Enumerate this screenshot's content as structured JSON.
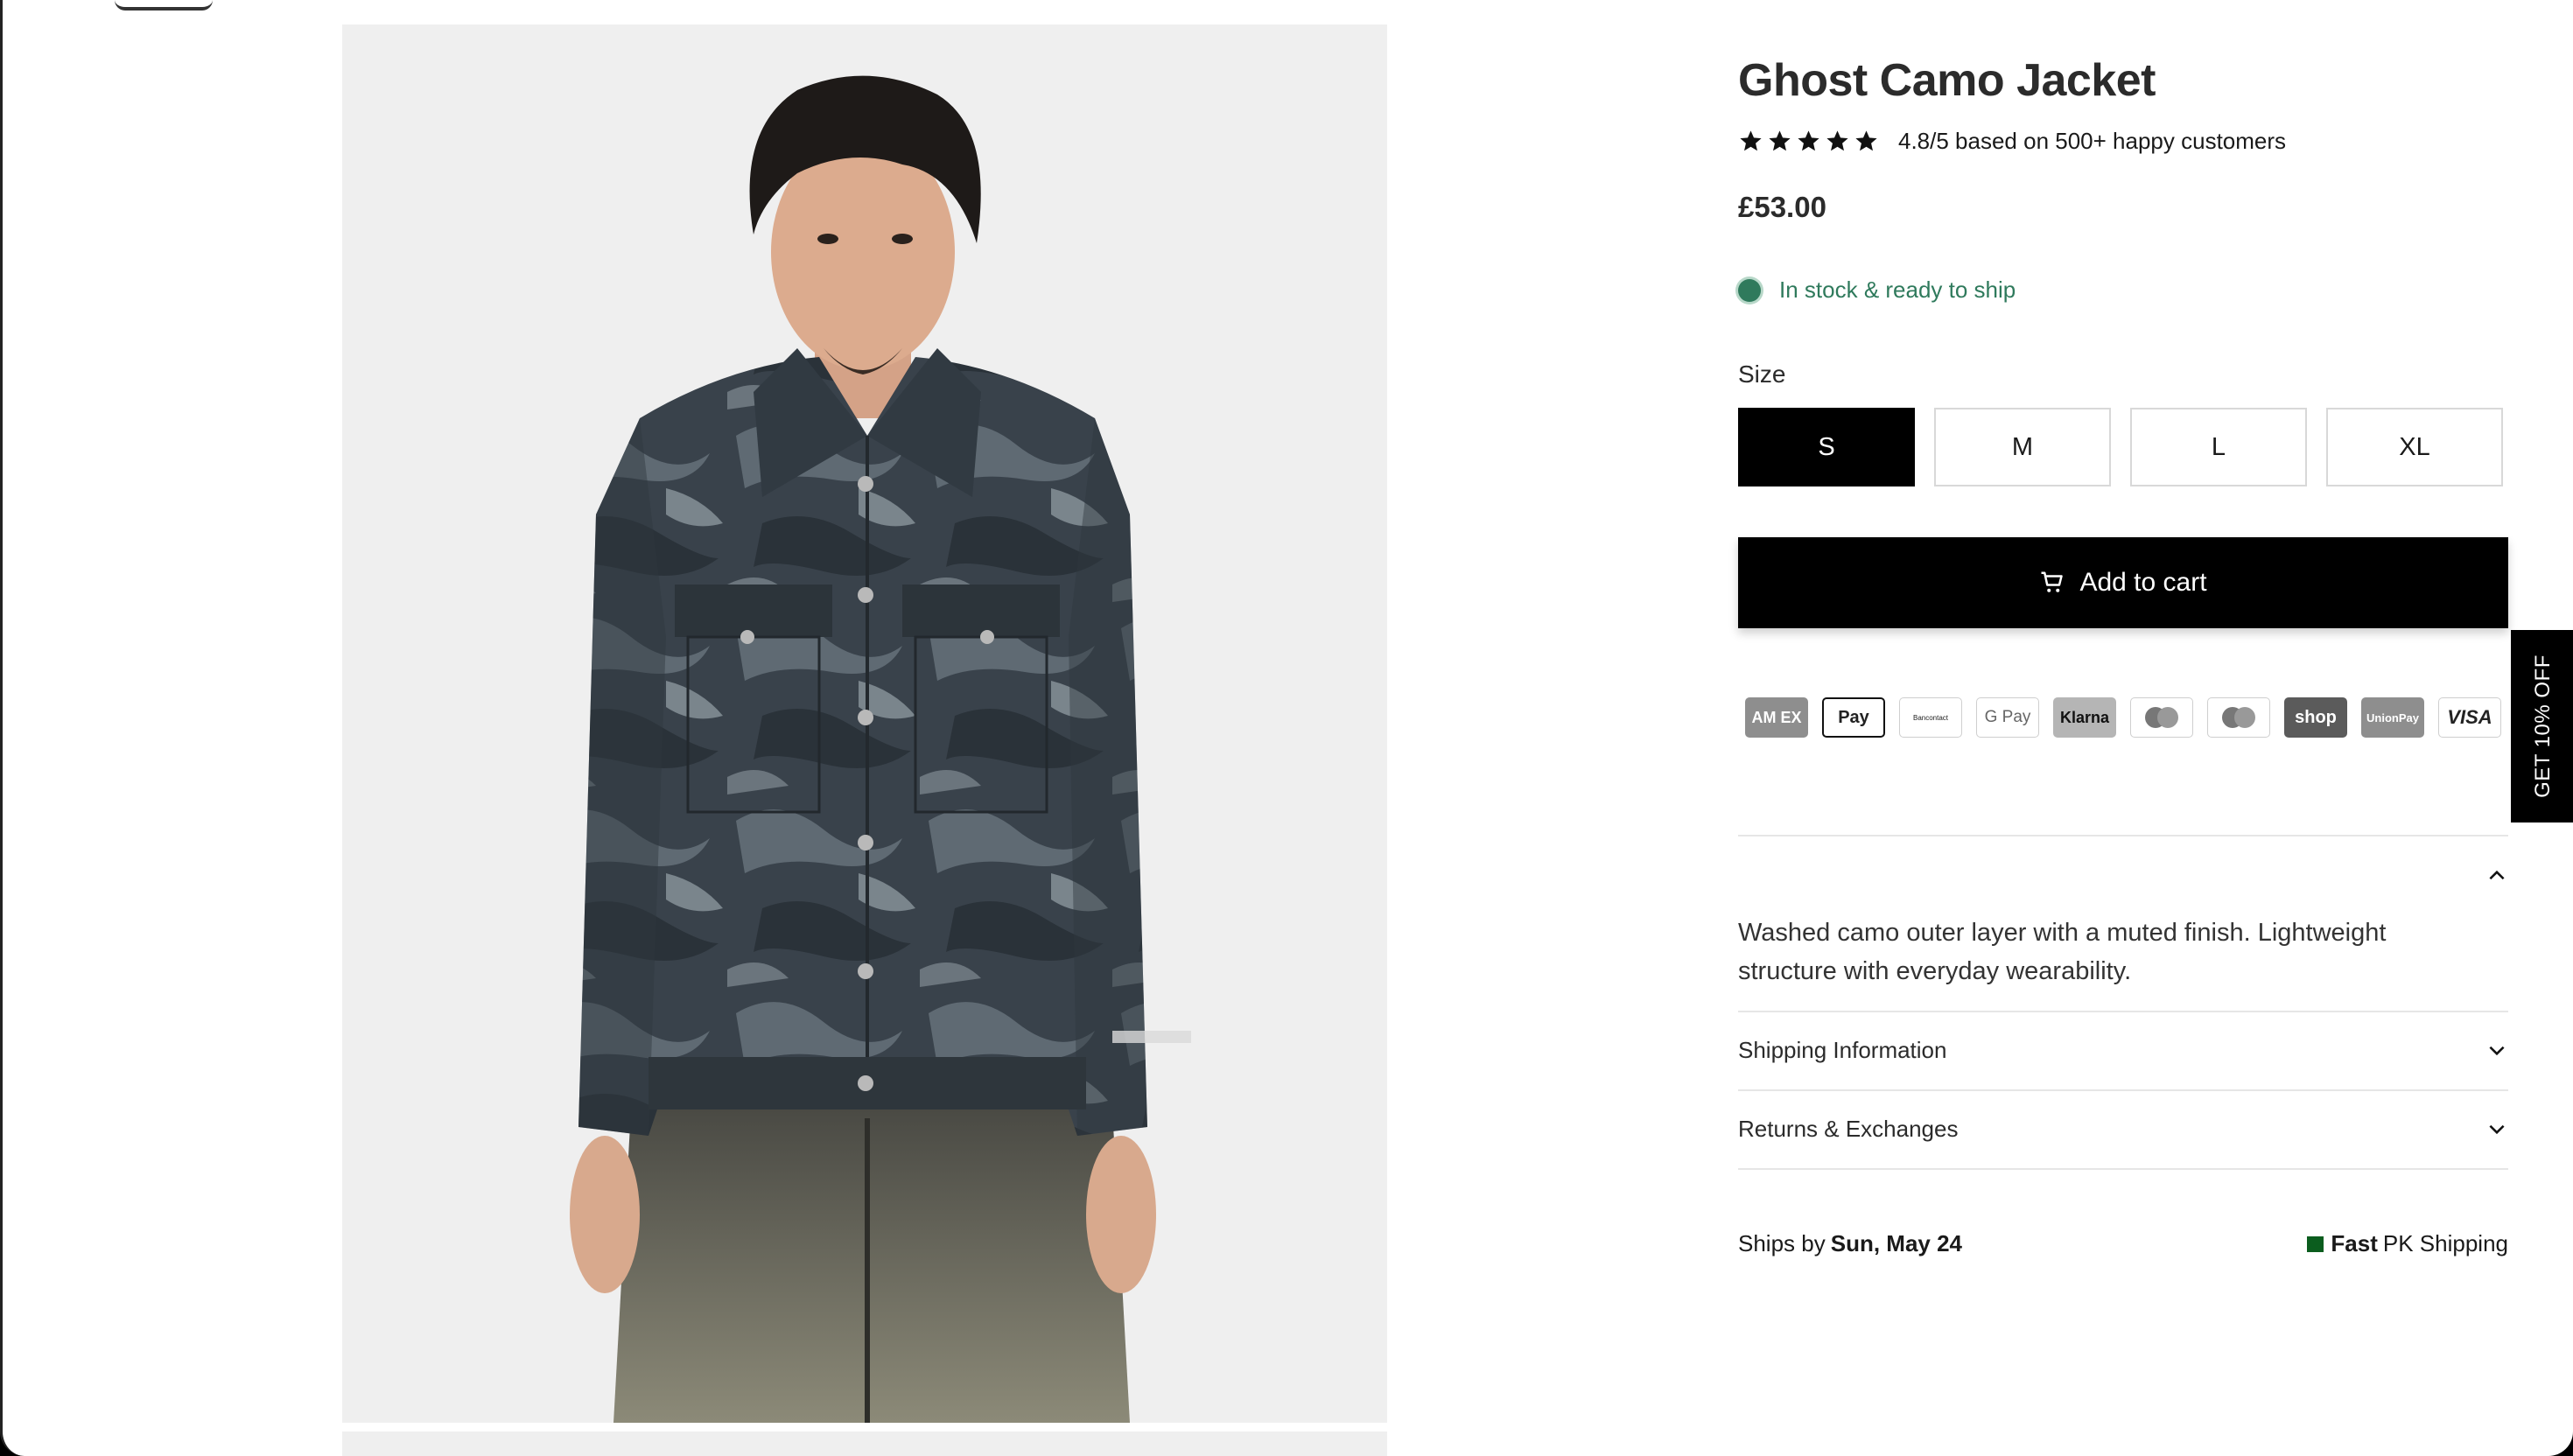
{
  "product": {
    "title": "Ghost Camo Jacket",
    "rating_text": "4.8/5 based on 500+ happy customers",
    "stars": 5,
    "price": "£53.00",
    "stock_text": "In stock & ready to ship",
    "stock_color": "#2f7a5c",
    "size_label": "Size",
    "sizes": [
      "S",
      "M",
      "L",
      "XL"
    ],
    "selected_size": "S",
    "add_to_cart": "Add to cart",
    "description": "Washed camo outer layer with a muted finish. Lightweight structure with everyday wearability."
  },
  "payments": {
    "amex": "AM EX",
    "applepay": "Pay",
    "bancontact": "Bancontact",
    "googlepay": "G Pay",
    "klarna": "Klarna",
    "shoppay": "shop",
    "unionpay": "UnionPay",
    "visa": "VISA"
  },
  "accordion": {
    "shipping": "Shipping Information",
    "returns": "Returns & Exchanges"
  },
  "shipping_note": {
    "prefix": "Ships by",
    "date": "Sun, May 24",
    "fast": "Fast",
    "suffix": "PK Shipping"
  },
  "side_tab": "GET 10% OFF",
  "colors": {
    "primary": "#000000",
    "stock_green": "#2f7a5c",
    "image_bg": "#efefef"
  },
  "icons": [
    "star-icon",
    "cart-icon",
    "chevron-up-icon",
    "chevron-down-icon",
    "pk-flag-icon"
  ]
}
